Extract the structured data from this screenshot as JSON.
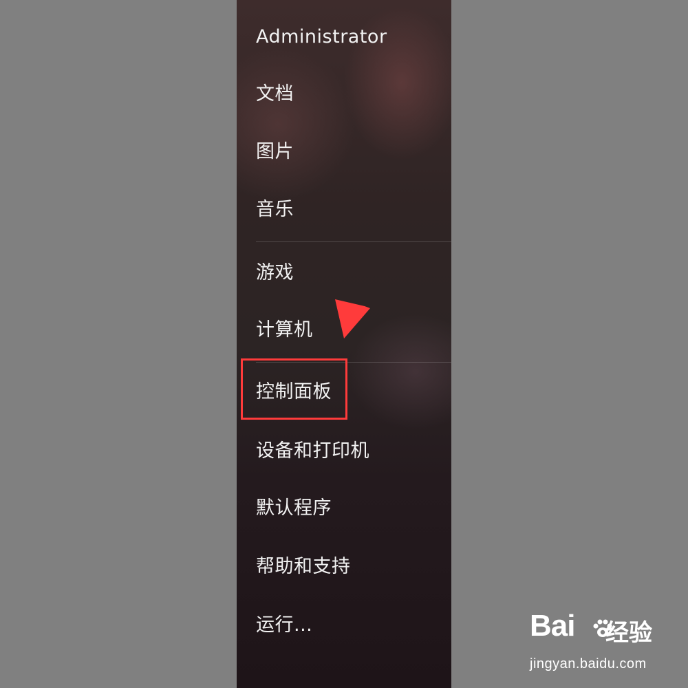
{
  "start_menu": {
    "items": [
      {
        "label": "Administrator"
      },
      {
        "label": "文档"
      },
      {
        "label": "图片"
      },
      {
        "label": "音乐"
      },
      {
        "label": "游戏"
      },
      {
        "label": "计算机"
      },
      {
        "label": "控制面板"
      },
      {
        "label": "设备和打印机"
      },
      {
        "label": "默认程序"
      },
      {
        "label": "帮助和支持"
      },
      {
        "label": "运行..."
      }
    ]
  },
  "annotation": {
    "arrow_color": "#ff3b3b",
    "highlight_color": "#ff3b3b",
    "highlighted_item": "控制面板"
  },
  "watermark": {
    "brand": "Bai",
    "brand_icon": "paw-icon",
    "brand_cn": "经验",
    "url": "jingyan.baidu.com"
  }
}
